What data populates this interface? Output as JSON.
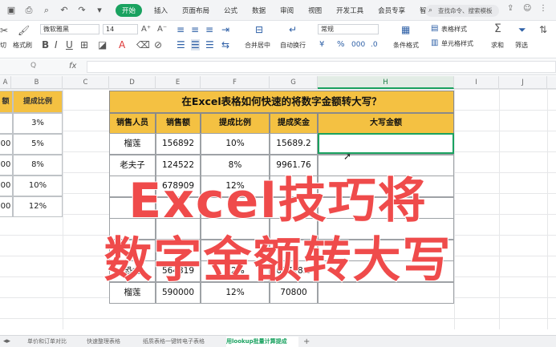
{
  "menu": {
    "start_label": "开始",
    "tabs": [
      "插入",
      "页面布局",
      "公式",
      "数据",
      "审阅",
      "视图",
      "开发工具",
      "会员专享",
      "智能工具箱"
    ],
    "search_text": "查找命令、搜索模板"
  },
  "ribbon": {
    "font_name": "微软雅黑",
    "font_size": "14",
    "number_format": "常规",
    "labels": {
      "format_painter": "格式刷",
      "merge_center": "合并居中",
      "wrap": "自动换行",
      "cond_format": "条件格式",
      "table_style": "表格样式",
      "cell_style": "单元格样式",
      "sum": "求和",
      "filter": "筛选",
      "paste": "切"
    }
  },
  "formula_bar": {
    "fx": "fx",
    "zoom": "Q"
  },
  "columns": [
    "A",
    "B",
    "C",
    "D",
    "E",
    "F",
    "G",
    "H",
    "I",
    "J"
  ],
  "left_table": {
    "headers": [
      "额间",
      "提成比例"
    ],
    "rows": [
      [
        "",
        "3%"
      ],
      [
        "00",
        "5%"
      ],
      [
        "00",
        "8%"
      ],
      [
        "00",
        "10%"
      ],
      [
        "00",
        "12%"
      ]
    ]
  },
  "main_table": {
    "title": "在Excel表格如何快速的将数字金额转大写？",
    "headers": [
      "销售人员",
      "销售额",
      "提成比例",
      "提成奖金",
      "大写金额"
    ],
    "rows": [
      [
        "榴莲",
        "156892",
        "10%",
        "15689.2",
        ""
      ],
      [
        "老夫子",
        "124522",
        "8%",
        "9961.76",
        ""
      ],
      [
        "",
        "678909",
        "12%",
        "",
        ""
      ],
      [
        "",
        "",
        "",
        "",
        ""
      ],
      [
        "",
        "",
        "",
        "",
        ""
      ],
      [
        "",
        "",
        "",
        "",
        ""
      ],
      [
        "恐龙",
        "564319",
        "12%",
        "67718.3",
        ""
      ],
      [
        "榴莲",
        "590000",
        "12%",
        "70800",
        ""
      ]
    ]
  },
  "overlay": {
    "line1": "Excel技巧将",
    "line2": "数字金额转大写"
  },
  "sheet_tabs": [
    "单价和订单对比",
    "快速整理表格",
    "纸质表格一键转电子表格",
    "用lookup批量计算提成"
  ]
}
